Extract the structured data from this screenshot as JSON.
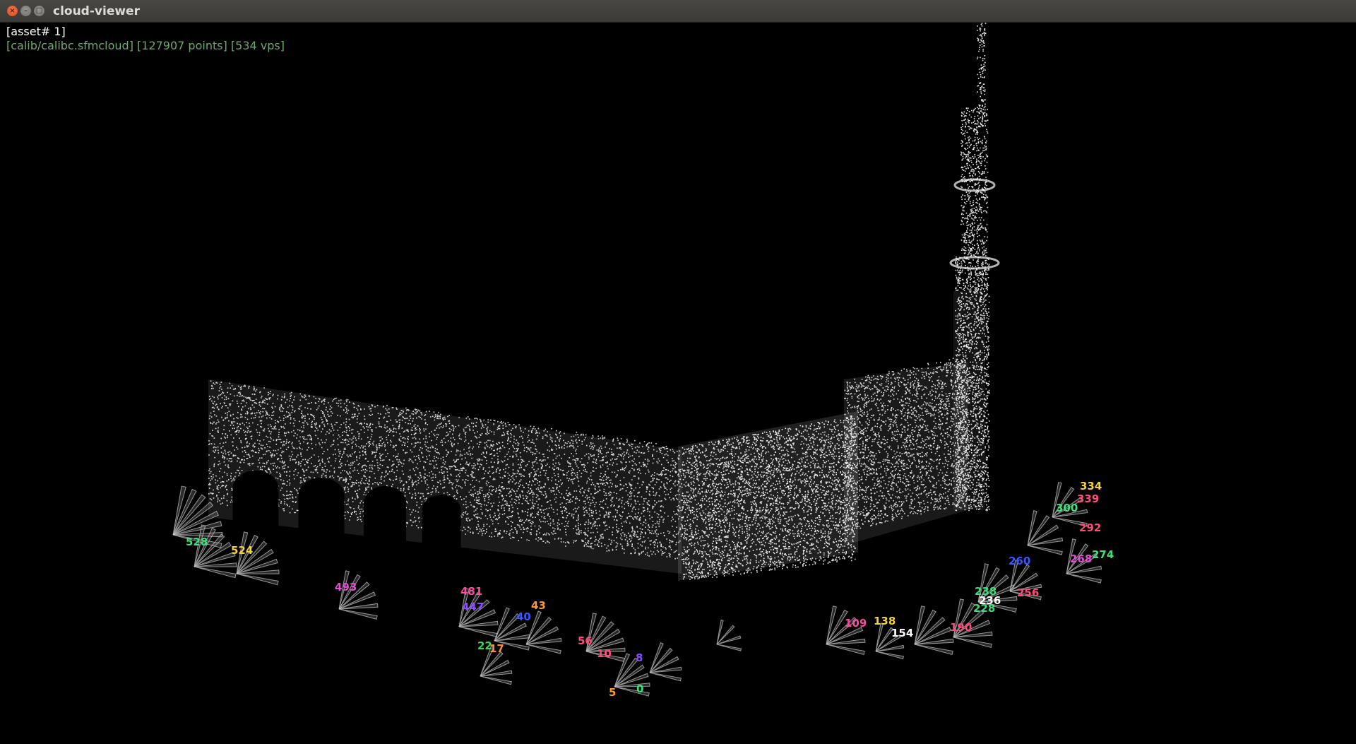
{
  "window": {
    "title": "cloud-viewer"
  },
  "hud": {
    "asset": "[asset# 1]",
    "info": "[calib/calibc.sfmcloud] [127907 points] [534 vps]"
  },
  "colors": {
    "background": "#000000",
    "points": "#ffffff",
    "hud_info": "#6fa86f"
  },
  "viewpoint_labels": [
    {
      "text": "528",
      "color": "#3be07a"
    },
    {
      "text": "524",
      "color": "#f3d23a"
    },
    {
      "text": "493",
      "color": "#e34dd3"
    },
    {
      "text": "481",
      "color": "#ff4aa0"
    },
    {
      "text": "447",
      "color": "#8a4dff"
    },
    {
      "text": "43",
      "color": "#ff9a2e"
    },
    {
      "text": "40",
      "color": "#3b55ff"
    },
    {
      "text": "22",
      "color": "#43d061"
    },
    {
      "text": "17",
      "color": "#ff8c2e"
    },
    {
      "text": "56",
      "color": "#ff4a7a"
    },
    {
      "text": "10",
      "color": "#ff4a7a"
    },
    {
      "text": "5",
      "color": "#ff9a2e"
    },
    {
      "text": "0",
      "color": "#3be07a"
    },
    {
      "text": "8",
      "color": "#8a4dff"
    },
    {
      "text": "109",
      "color": "#ff4aa0"
    },
    {
      "text": "138",
      "color": "#f3d23a"
    },
    {
      "text": "154",
      "color": "#ffffff"
    },
    {
      "text": "190",
      "color": "#ff4a7a"
    },
    {
      "text": "228",
      "color": "#3be07a"
    },
    {
      "text": "238",
      "color": "#3be07a"
    },
    {
      "text": "236",
      "color": "#ffffff"
    },
    {
      "text": "256",
      "color": "#ff4a7a"
    },
    {
      "text": "260",
      "color": "#3b55ff"
    },
    {
      "text": "268",
      "color": "#e34dd3"
    },
    {
      "text": "274",
      "color": "#3be07a"
    },
    {
      "text": "292",
      "color": "#ff4a7a"
    },
    {
      "text": "300",
      "color": "#3be07a"
    },
    {
      "text": "334",
      "color": "#f3d23a"
    },
    {
      "text": "339",
      "color": "#ff4a7a"
    }
  ]
}
